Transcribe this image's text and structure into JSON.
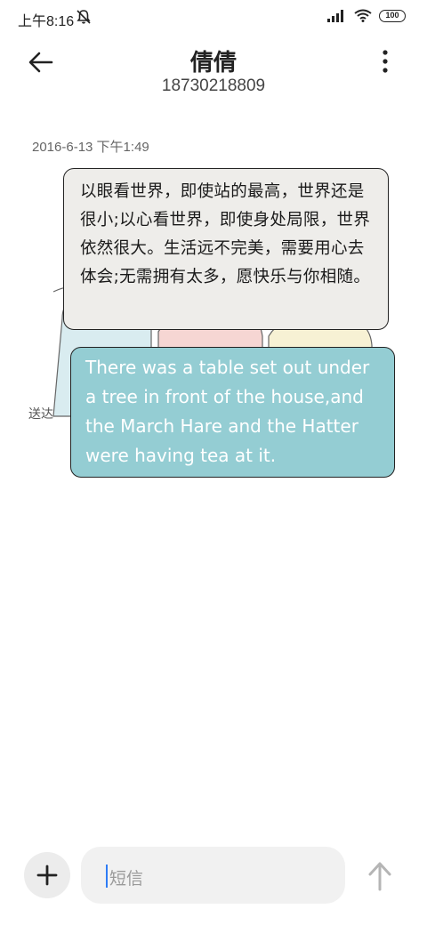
{
  "status_bar": {
    "time": "上午8:16",
    "battery": "100"
  },
  "header": {
    "contact_name": "倩倩",
    "phone_number": "18730218809"
  },
  "conversation": {
    "timestamp": "2016-6-13 下午1:49",
    "received_message": "以眼看世界，即使站的最高，世界还是很小;以心看世界，即使身处局限，世界依然很大。生活远不完美，需要用心去体会;无需拥有太多，愿快乐与你相随。",
    "sent_message": "There was a table set out under a tree in front of the house,and the March Hare and the Hatter were having tea at it.",
    "delivery_status": "送达"
  },
  "composer": {
    "placeholder": "短信"
  },
  "colors": {
    "received_bubble": "#eeedea",
    "sent_bubble": "#94cdd3",
    "caret": "#2e7cf6"
  },
  "icons": [
    "mute-icon",
    "signal-icon",
    "wifi-icon",
    "battery-icon",
    "back-arrow-icon",
    "more-vertical-icon",
    "plus-icon",
    "send-arrow-icon"
  ]
}
